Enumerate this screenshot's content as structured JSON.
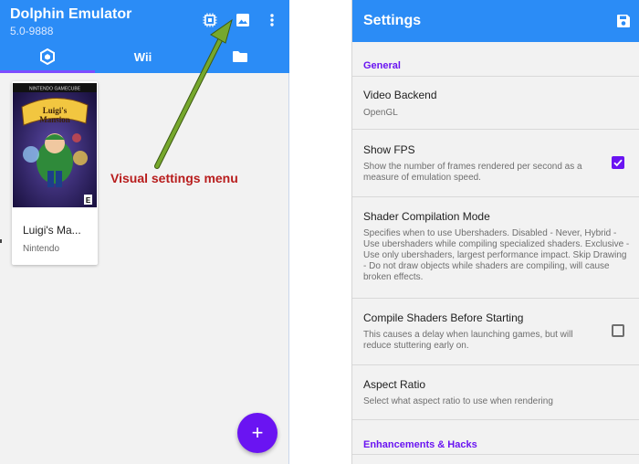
{
  "left_app": {
    "title": "Dolphin Emulator",
    "version": "5.0-9888",
    "tabs": [
      {
        "name": "gamecube",
        "label": "",
        "icon": "gamecube-icon"
      },
      {
        "name": "wii",
        "label": "Wii"
      },
      {
        "name": "folder",
        "label": "",
        "icon": "folder-icon"
      }
    ],
    "games": [
      {
        "title": "Luigi's Ma...",
        "publisher": "Nintendo",
        "cover_text": "Luigi's Mansion",
        "cover_brand": "NINTENDO GAMECUBE"
      }
    ],
    "annotation": "Visual settings menu",
    "fab_label": "+"
  },
  "settings": {
    "title": "Settings",
    "sections": [
      {
        "header": "General"
      },
      {
        "header": "Enhancements & Hacks"
      }
    ],
    "items": [
      {
        "title": "Video Backend",
        "description": "OpenGL"
      },
      {
        "title": "Show FPS",
        "description": "Show the number of frames rendered per second as a measure of emulation speed.",
        "checked": true
      },
      {
        "title": "Shader Compilation Mode",
        "description": "Specifies when to use Ubershaders. Disabled - Never, Hybrid - Use ubershaders while compiling specialized shaders. Exclusive - Use only ubershaders, largest performance impact. Skip Drawing - Do not draw objects while shaders are compiling, will cause broken effects."
      },
      {
        "title": "Compile Shaders Before Starting",
        "description": "This causes a delay when launching games, but will reduce stuttering early on.",
        "checked": false
      },
      {
        "title": "Aspect Ratio",
        "description": "Select what aspect ratio to use when rendering"
      }
    ]
  },
  "colors": {
    "app_bar": "#2b8cf6",
    "accent": "#6a14f2",
    "annotation": "#b81d1d",
    "arrow": "#76a82d"
  }
}
